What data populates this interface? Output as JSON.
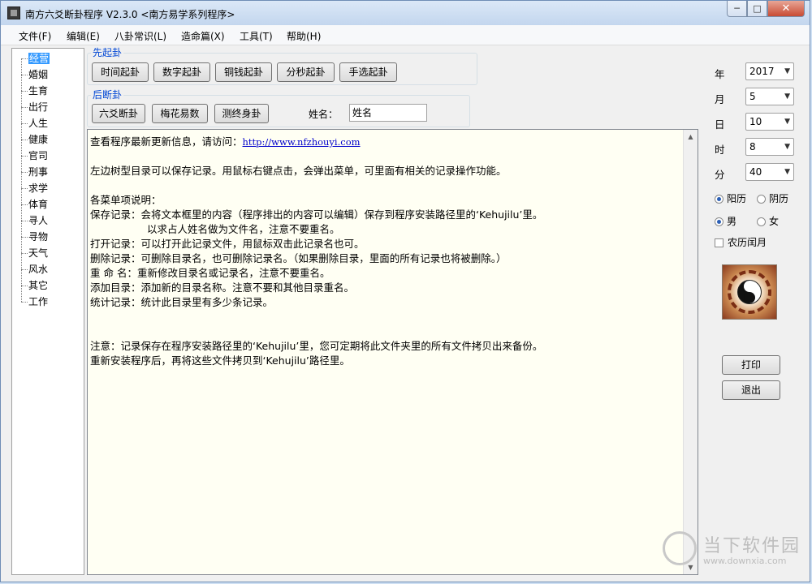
{
  "window": {
    "title": "南方六爻断卦程序 V2.3.0   <南方易学系列程序>",
    "minimize_glyph": "─",
    "maximize_glyph": "□",
    "close_glyph": "✕"
  },
  "menu": {
    "items": [
      {
        "label": "文件(F)"
      },
      {
        "label": "编辑(E)"
      },
      {
        "label": "八卦常识(L)"
      },
      {
        "label": "造命篇(X)"
      },
      {
        "label": "工具(T)"
      },
      {
        "label": "帮助(H)"
      }
    ]
  },
  "tree": {
    "items": [
      "经营",
      "婚姻",
      "生育",
      "出行",
      "人生",
      "健康",
      "官司",
      "刑事",
      "求学",
      "体育",
      "寻人",
      "寻物",
      "天气",
      "风水",
      "其它",
      "工作"
    ],
    "selected_index": 0
  },
  "group_first": {
    "label": "先起卦",
    "buttons": [
      "时间起卦",
      "数字起卦",
      "铜钱起卦",
      "分秒起卦",
      "手选起卦"
    ]
  },
  "group_after": {
    "label": "后断卦",
    "buttons": [
      "六爻断卦",
      "梅花易数",
      "测终身卦"
    ]
  },
  "name": {
    "label": "姓名：",
    "value": "姓名"
  },
  "content": {
    "line1_prefix": "查看程序最新更新信息，请访问：",
    "line1_link": "http://www.nfzhouyi.com",
    "line2": "左边树型目录可以保存记录。用鼠标右键点击，会弹出菜单，可里面有相关的记录操作功能。",
    "line3": "各菜单项说明：",
    "line4": "保存记录：会将文本框里的内容（程序排出的内容可以编辑）保存到程序安装路径里的‘Kehujilu’里。",
    "line5": "以求占人姓名做为文件名，注意不要重名。",
    "line6": "打开记录：可以打开此记录文件，用鼠标双击此记录名也可。",
    "line7": "删除记录：可删除目录名，也可删除记录名。（如果删除目录，里面的所有记录也将被删除。）",
    "line8": "重 命 名：重新修改目录名或记录名，注意不要重名。",
    "line9": "添加目录：添加新的目录名称。注意不要和其他目录重名。",
    "line10": "统计记录：统计此目录里有多少条记录。",
    "line11": "注意：记录保存在程序安装路径里的‘Kehujilu’里，您可定期将此文件夹里的所有文件拷贝出来备份。",
    "line12": "重新安装程序后，再将这些文件拷贝到‘Kehujilu’路径里。"
  },
  "date": {
    "year_label": "年",
    "year_value": "2017",
    "month_label": "月",
    "month_value": "5",
    "day_label": "日",
    "day_value": "10",
    "hour_label": "时",
    "hour_value": "8",
    "minute_label": "分",
    "minute_value": "40"
  },
  "calendar": {
    "solar": "阳历",
    "lunar": "阴历",
    "selected": "solar"
  },
  "gender": {
    "male": "男",
    "female": "女",
    "selected": "male"
  },
  "leap_month": {
    "label": "农历闰月",
    "checked": false
  },
  "actions": {
    "print": "打印",
    "exit": "退出"
  },
  "watermark": {
    "cn": "当下软件园",
    "url": "www.downxia.com"
  }
}
